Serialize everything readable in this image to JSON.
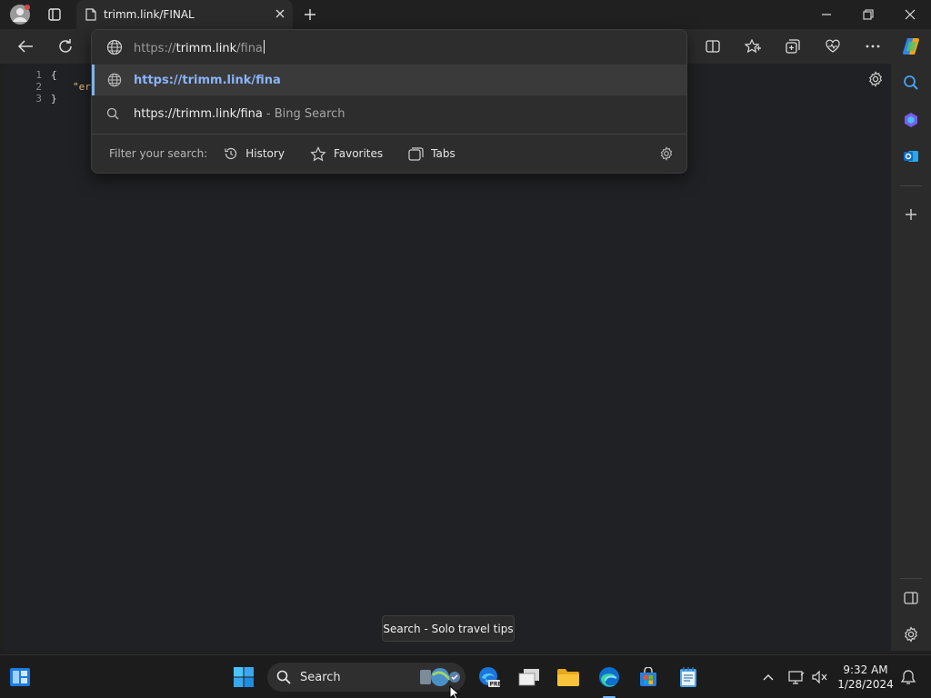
{
  "tab": {
    "title": "trimm.link/FINAL"
  },
  "address_bar": {
    "scheme": "https://",
    "host": "trimm.link",
    "path": "/fina"
  },
  "suggestions": [
    {
      "type": "url",
      "text": "https://trimm.link/fina",
      "suffix": ""
    },
    {
      "type": "search",
      "text": "https://trimm.link/fina",
      "suffix": "- Bing Search"
    }
  ],
  "filter": {
    "label": "Filter your search:",
    "chips": [
      {
        "label": "History",
        "icon": "history-icon"
      },
      {
        "label": "Favorites",
        "icon": "star-icon"
      },
      {
        "label": "Tabs",
        "icon": "tabs-icon"
      }
    ]
  },
  "code": {
    "lines": [
      {
        "num": "1",
        "text": "{"
      },
      {
        "num": "2",
        "text": "\"er"
      },
      {
        "num": "3",
        "text": "}"
      }
    ]
  },
  "tooltip": {
    "text": "Search - Solo travel tips"
  },
  "taskbar": {
    "search_label": "Search",
    "time": "9:32 AM",
    "date": "1/28/2024"
  },
  "colors": {
    "accent": "#8ab4f8",
    "selection_bar": "#7fb3e6"
  }
}
